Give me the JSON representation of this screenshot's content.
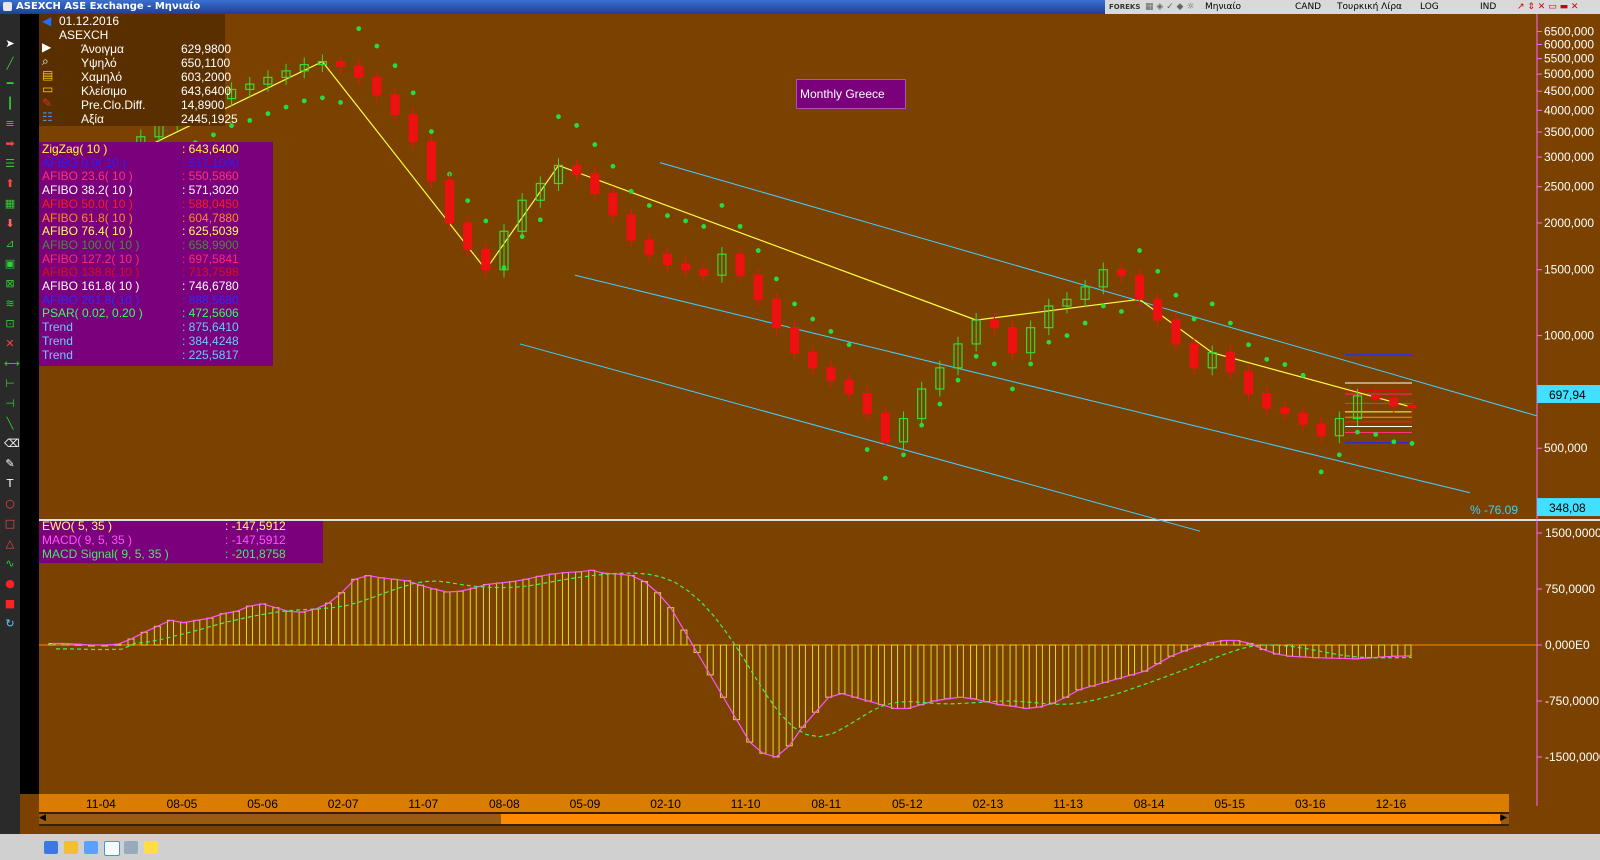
{
  "window": {
    "title": "ASEXCH ASE Exchange - Μηνιαίο"
  },
  "toolbar": {
    "period": "Μηνιαίο",
    "chart_type": "CAND",
    "currency": "Τουρκική Λίρα",
    "scale": "LOG",
    "ind": "IND",
    "brand": "FOREKS"
  },
  "ohlc": {
    "date": "01.12.2016",
    "symbol": "ASEXCH",
    "rows": [
      {
        "label": "Άνοιγμα",
        "value": "629,9800"
      },
      {
        "label": "Υψηλό",
        "value": "650,1100"
      },
      {
        "label": "Χαμηλό",
        "value": "603,2000"
      },
      {
        "label": "Κλείσιμο",
        "value": "643,6400"
      },
      {
        "label": "Pre.Clo.Diff.",
        "value": "14,8900"
      },
      {
        "label": "Αξία",
        "value": "2445,1925"
      }
    ]
  },
  "indicators": [
    {
      "label": "ZigZag( 10 )",
      "value": ": 643,6400",
      "color": "#ffff40"
    },
    {
      "label": "AFIBO 0.0( 10 )",
      "value": ": 517,1000",
      "color": "#2222ff"
    },
    {
      "label": "AFIBO 23.6( 10 )",
      "value": ": 550,5860",
      "color": "#ff3377"
    },
    {
      "label": "AFIBO 38.2( 10 )",
      "value": ": 571,3020",
      "color": "#ffffff"
    },
    {
      "label": "AFIBO 50.0( 10 )",
      "value": ": 588,0450",
      "color": "#ff1a1a"
    },
    {
      "label": "AFIBO 61.8( 10 )",
      "value": ": 604,7880",
      "color": "#ff8c1a"
    },
    {
      "label": "AFIBO 76.4( 10 )",
      "value": ": 625,5039",
      "color": "#ffff66"
    },
    {
      "label": "AFIBO 100.0( 10 )",
      "value": ": 658,9900",
      "color": "#4a8a3a"
    },
    {
      "label": "AFIBO 127.2( 10 )",
      "value": ": 697,5841",
      "color": "#ff2a6a"
    },
    {
      "label": "AFIBO 138.8( 10 )",
      "value": ": 713,7598",
      "color": "#d81010"
    },
    {
      "label": "AFIBO 161.8( 10 )",
      "value": ": 746,6780",
      "color": "#ffffff"
    },
    {
      "label": "AFIBO 261.8( 10 )",
      "value": ": 888,5680",
      "color": "#2a2aff"
    },
    {
      "label": "PSAR( 0.02, 0.20 )",
      "value": ": 472,5606",
      "color": "#33ff66"
    },
    {
      "label": "Trend",
      "value": ": 875,6410",
      "color": "#66ccff"
    },
    {
      "label": "Trend",
      "value": ": 384,4248",
      "color": "#66ccff"
    },
    {
      "label": "Trend",
      "value": ": 225,5817",
      "color": "#66ccff"
    }
  ],
  "oscillators": [
    {
      "label": "EWO( 5, 35 )",
      "value": ": -147,5912",
      "color": "#ffff66"
    },
    {
      "label": "MACD( 9, 5, 35 )",
      "value": ": -147,5912",
      "color": "#ff55ff"
    },
    {
      "label": "MACD Signal( 9, 5, 35 )",
      "value": ": -201,8758",
      "color": "#44ee66"
    }
  ],
  "annotation": {
    "text": "Monthly Greece"
  },
  "price_axis": {
    "labels": [
      "6500,000",
      "6000,000",
      "5500,000",
      "5000,000",
      "4500,000",
      "4000,000",
      "3500,000",
      "3000,000",
      "2500,000",
      "2000,000",
      "1500,000",
      "1000,000",
      "500,000"
    ],
    "markers": [
      {
        "value": "697,94",
        "color": "#40e0ff"
      },
      {
        "value": "348,08",
        "color": "#40e0ff"
      }
    ],
    "percent_label": "% -76.09"
  },
  "osc_axis": {
    "labels": [
      "1500,0000",
      "750,0000",
      "0,000E0",
      "-750,0000",
      "-1500,0000"
    ]
  },
  "date_axis": {
    "labels": [
      "11-04",
      "08-05",
      "05-06",
      "02-07",
      "11-07",
      "08-08",
      "05-09",
      "02-10",
      "11-10",
      "08-11",
      "05-12",
      "02-13",
      "11-13",
      "08-14",
      "05-15",
      "03-16",
      "12-16"
    ]
  },
  "colors": {
    "background": "#7a4100",
    "candle_up": "#33dd33",
    "candle_down": "#ee1111",
    "psar": "#22dd44",
    "channel": "#40d0ff",
    "zigzag": "#ffff40",
    "ewo_bars": "#dddd22",
    "macd": "#ff55ff",
    "signal": "#44ee66"
  },
  "chart_data": [
    {
      "type": "candlestick",
      "title": "ASEXCH",
      "scale": "log",
      "ylim": [
        348.08,
        6500
      ],
      "x_ticks": [
        "11-04",
        "08-05",
        "05-06",
        "02-07",
        "11-07",
        "08-08",
        "05-09",
        "02-10",
        "11-10",
        "08-11",
        "05-12",
        "02-13",
        "11-13",
        "08-14",
        "05-15",
        "03-16",
        "12-16"
      ],
      "close_series_approx": [
        2400,
        2550,
        2750,
        2950,
        3150,
        3400,
        3700,
        3900,
        4100,
        4300,
        4550,
        4700,
        4900,
        5100,
        5300,
        5400,
        5250,
        4900,
        4400,
        3900,
        3300,
        2600,
        2000,
        1700,
        1500,
        1900,
        2300,
        2550,
        2850,
        2700,
        2400,
        2100,
        1800,
        1650,
        1550,
        1500,
        1450,
        1650,
        1450,
        1250,
        1050,
        900,
        820,
        760,
        700,
        620,
        520,
        600,
        720,
        820,
        950,
        1100,
        1050,
        900,
        1050,
        1200,
        1250,
        1350,
        1500,
        1450,
        1250,
        1100,
        950,
        820,
        900,
        800,
        700,
        640,
        620,
        580,
        540,
        600,
        690,
        680,
        650,
        643.64
      ],
      "last": {
        "open": 629.98,
        "high": 650.11,
        "low": 603.2,
        "close": 643.64
      },
      "overlays": [
        "ZigZag(10)",
        "AFIBO(10)",
        "PSAR(0.02,0.20)",
        "Trend x3"
      ]
    },
    {
      "type": "bar",
      "title": "EWO( 5, 35 )",
      "ylim": [
        -1500,
        1500
      ],
      "values_approx": [
        20,
        20,
        10,
        0,
        0,
        10,
        80,
        170,
        250,
        330,
        300,
        330,
        360,
        420,
        450,
        520,
        550,
        500,
        450,
        440,
        480,
        560,
        700,
        880,
        930,
        900,
        880,
        860,
        800,
        750,
        710,
        720,
        760,
        810,
        830,
        850,
        880,
        920,
        950,
        970,
        980,
        1000,
        960,
        950,
        930,
        850,
        700,
        500,
        200,
        -100,
        -400,
        -700,
        -1000,
        -1300,
        -1450,
        -1500,
        -1350,
        -1100,
        -900,
        -700,
        -650,
        -700,
        -750,
        -800,
        -850,
        -850,
        -800,
        -750,
        -720,
        -700,
        -720,
        -760,
        -800,
        -820,
        -850,
        -830,
        -780,
        -700,
        -600,
        -550,
        -500,
        -450,
        -400,
        -350,
        -250,
        -150,
        -80,
        -20,
        30,
        60,
        60,
        20,
        -60,
        -120,
        -150,
        -160,
        -170,
        -175,
        -180,
        -185,
        -175,
        -160,
        -150,
        -147.59
      ],
      "series": [
        {
          "name": "MACD( 9, 5, 35 )",
          "last": -147.5912
        },
        {
          "name": "MACD Signal( 9, 5, 35 )",
          "last": -201.8758
        }
      ]
    }
  ]
}
